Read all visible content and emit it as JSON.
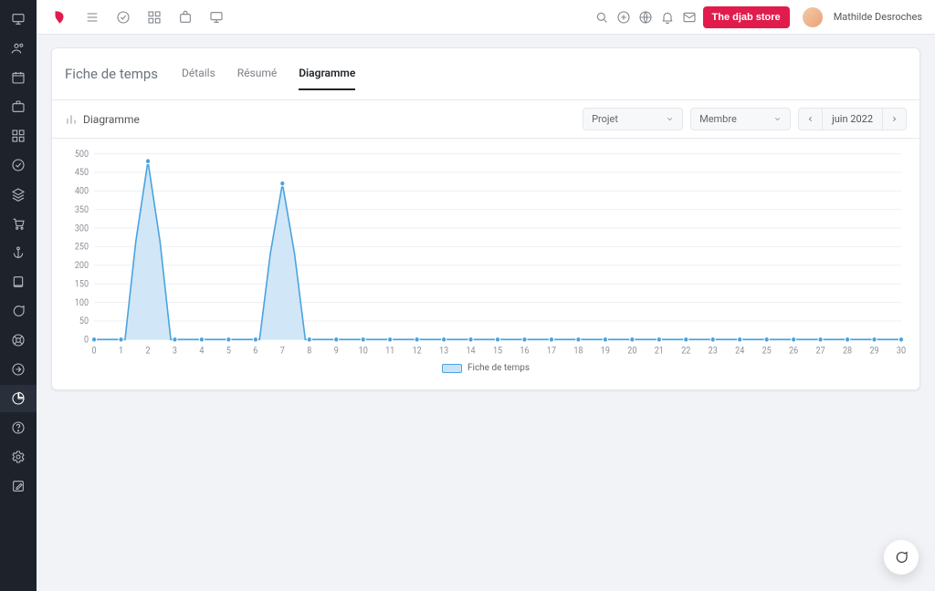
{
  "topbar": {
    "store_button": "The djab store",
    "user_name": "Mathilde Desroches"
  },
  "page": {
    "title": "Fiche de temps",
    "tabs": [
      "Détails",
      "Résumé",
      "Diagramme"
    ],
    "active_tab": 2,
    "section_label": "Diagramme",
    "filter_project": "Projet",
    "filter_member": "Membre",
    "period_label": "juin 2022"
  },
  "legend": {
    "label": "Fiche de temps"
  },
  "chart_data": {
    "type": "area",
    "title": "",
    "xlabel": "",
    "ylabel": "",
    "xlim": [
      0,
      30
    ],
    "ylim": [
      0,
      500
    ],
    "yticks": [
      0,
      50,
      100,
      150,
      200,
      250,
      300,
      350,
      400,
      450,
      500
    ],
    "xticks": [
      0,
      1,
      2,
      3,
      4,
      5,
      6,
      7,
      8,
      9,
      10,
      11,
      12,
      13,
      14,
      15,
      16,
      17,
      18,
      19,
      20,
      21,
      22,
      23,
      24,
      25,
      26,
      27,
      28,
      29,
      30
    ],
    "series": [
      {
        "name": "Fiche de temps",
        "x": [
          0,
          1,
          2,
          3,
          4,
          5,
          6,
          7,
          8,
          9,
          10,
          11,
          12,
          13,
          14,
          15,
          16,
          17,
          18,
          19,
          20,
          21,
          22,
          23,
          24,
          25,
          26,
          27,
          28,
          29,
          30
        ],
        "y": [
          0,
          0,
          480,
          0,
          0,
          0,
          0,
          420,
          0,
          0,
          0,
          0,
          0,
          0,
          0,
          0,
          0,
          0,
          0,
          0,
          0,
          0,
          0,
          0,
          0,
          0,
          0,
          0,
          0,
          0,
          0
        ]
      }
    ]
  }
}
